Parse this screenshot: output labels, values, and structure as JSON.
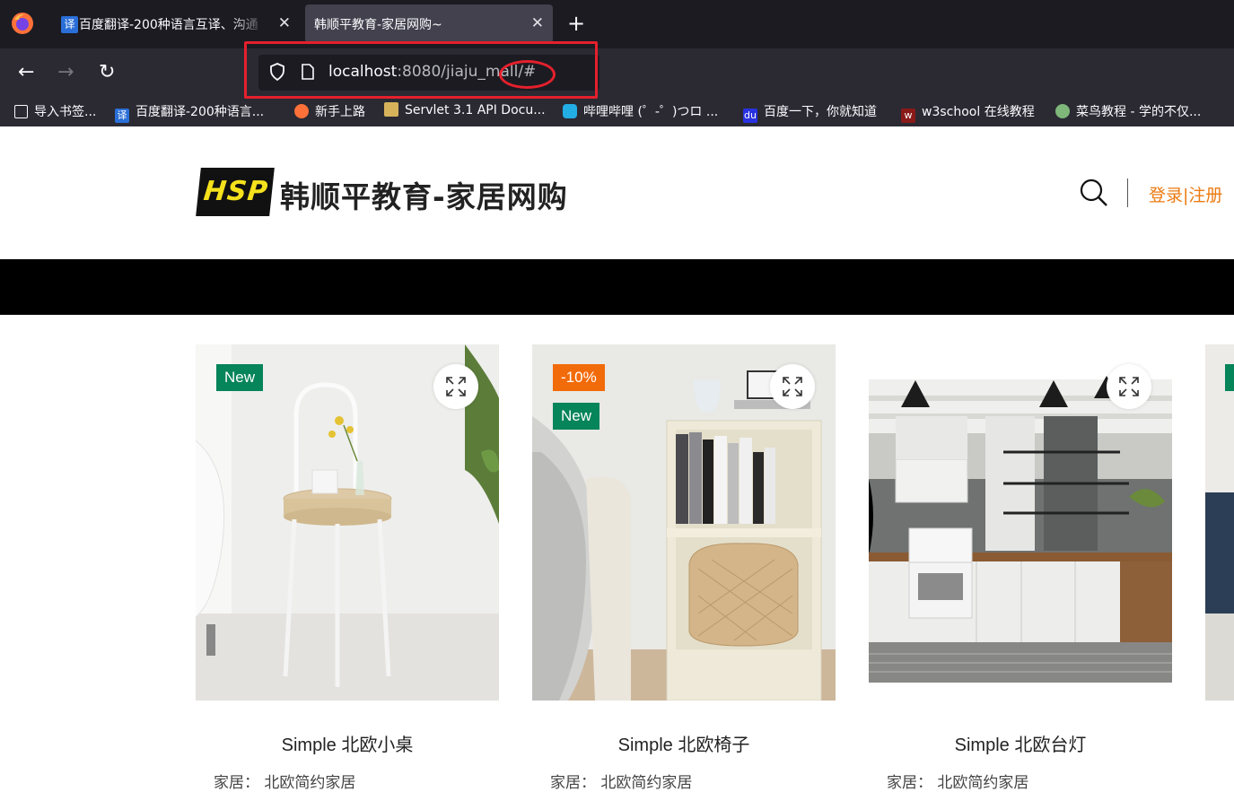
{
  "browser": {
    "tabs": [
      {
        "title": "百度翻译-200种语言互译、沟通",
        "favicon": "译"
      },
      {
        "title": "韩顺平教育-家居网购~",
        "active": true
      }
    ],
    "url_host": "localhost",
    "url_path": ":8080/jiaju_mall/#",
    "bookmarks": [
      {
        "label": "导入书签...",
        "icon": "import-icon"
      },
      {
        "label": "百度翻译-200种语言...",
        "icon": "translate-icon"
      },
      {
        "label": "新手上路",
        "icon": "firefox-icon"
      },
      {
        "label": "Servlet 3.1 API Docu...",
        "icon": "tomcat-icon"
      },
      {
        "label": "哔哩哔哩 (゜-゜)つロ ...",
        "icon": "bilibili-icon"
      },
      {
        "label": "百度一下，你就知道",
        "icon": "baidu-icon"
      },
      {
        "label": "w3school 在线教程",
        "icon": "w3school-icon"
      },
      {
        "label": "菜鸟教程 - 学的不仅...",
        "icon": "runoob-icon"
      }
    ]
  },
  "site": {
    "logo_mark": "HSP",
    "logo_text": "韩顺平教育-家居网购",
    "auth_text": "登录|注册"
  },
  "products": [
    {
      "name": "Simple 北欧小桌",
      "badges": [
        "New"
      ],
      "meta": "家居：   北欧简约家居"
    },
    {
      "name": "Simple 北欧椅子",
      "badges": [
        "-10%",
        "New"
      ],
      "meta": "家居：   北欧简约家居"
    },
    {
      "name": "Simple 北欧台灯",
      "badges": [],
      "meta": "家居：   北欧简约家居"
    }
  ],
  "colors": {
    "accent": "#ec7a12",
    "badge_new": "#06845a",
    "badge_sale": "#f26b0a",
    "annotation": "#e5202c"
  }
}
